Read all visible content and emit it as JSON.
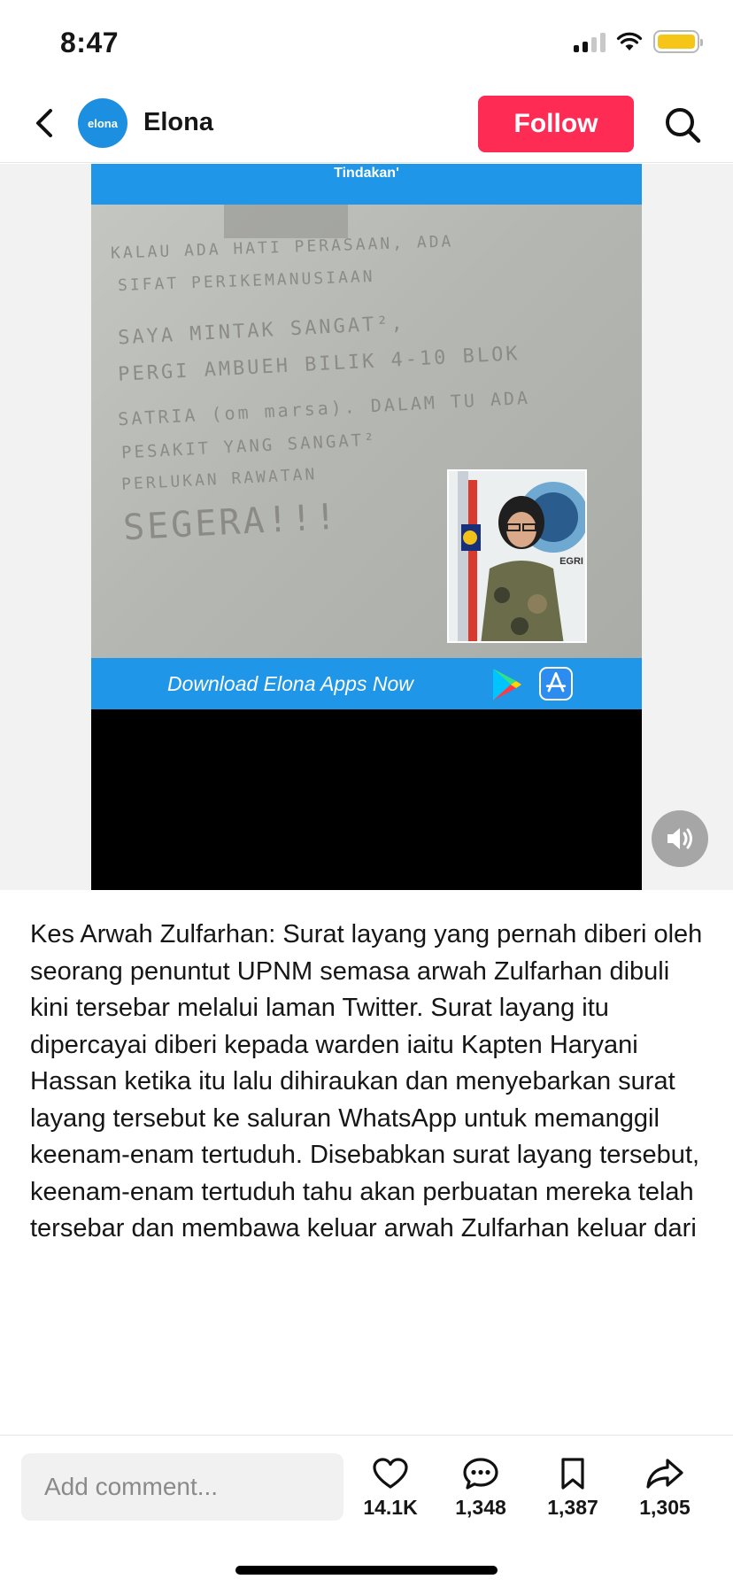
{
  "status_bar": {
    "time": "8:47",
    "battery_color": "#f5c518"
  },
  "header": {
    "account_name": "Elona",
    "avatar_text": "elona",
    "follow_label": "Follow",
    "follow_color": "#fe2c55",
    "icons": {
      "back": "chevron-left-icon",
      "search": "search-icon"
    }
  },
  "media": {
    "banner_top_text": "Tindakan'",
    "banner_bottom_text": "Download Elona Apps Now",
    "banner_color": "#1f96e8",
    "note_lines": [
      "KALAU ADA HATI PERASAAN, ADA",
      "SIFAT PERIKEMANUSIAAN",
      "SAYA MINTAK SANGAT²,",
      "PERGI AMBUEH BILIK 4-10 BLOK",
      "SATRIA (om marsa). DALAM TU ADA",
      "PESAKIT YANG SANGAT²",
      "PERLUKAN RAWATAN",
      "SEGERA!!!"
    ],
    "inset_badge_text": "EGRI",
    "icons": {
      "play_store": "google-play-icon",
      "app_store": "app-store-icon",
      "sound": "speaker-icon"
    }
  },
  "caption": "Kes Arwah Zulfarhan: Surat layang yang pernah diberi oleh seorang penuntut UPNM semasa arwah Zulfarhan dibuli kini tersebar melalui laman Twitter. Surat layang itu dipercayai diberi kepada warden iaitu Kapten Haryani Hassan ketika itu lalu dihiraukan dan menyebarkan surat layang tersebut ke saluran WhatsApp untuk memanggil keenam-enam tertuduh. Disebabkan surat layang tersebut, keenam-enam tertuduh tahu akan perbuatan mereka telah tersebar dan membawa keluar arwah Zulfarhan keluar dari UPNM. Surat layan tersebut dikatakan pernah diselitkan pada pintu pagar namun tidak dihiraukan. Warden ketika itu juga",
  "bottom_bar": {
    "comment_placeholder": "Add comment...",
    "likes": "14.1K",
    "comments": "1,348",
    "saves": "1,387",
    "shares": "1,305",
    "icons": {
      "like": "heart-icon",
      "comment": "comment-bubble-icon",
      "save": "bookmark-icon",
      "share": "share-arrow-icon"
    }
  }
}
